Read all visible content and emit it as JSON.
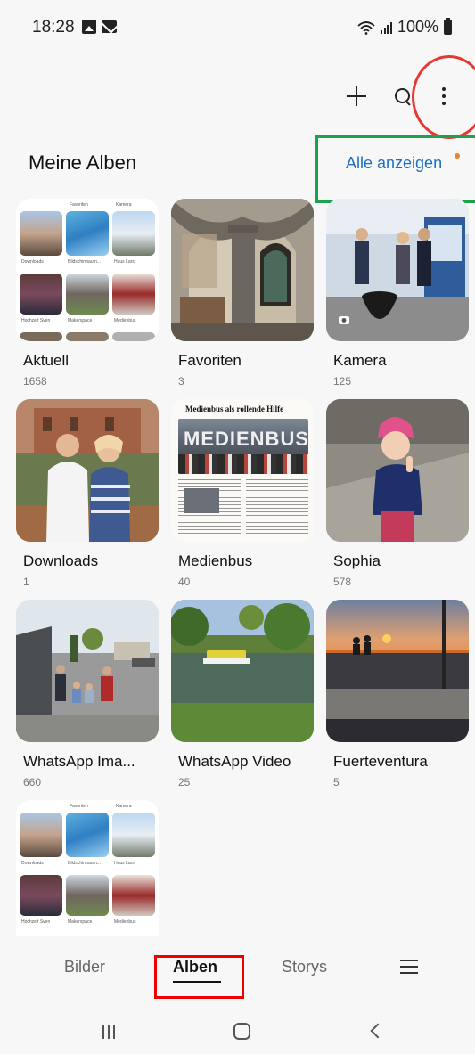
{
  "status_bar": {
    "time": "18:28",
    "battery": "100%",
    "icons": [
      "gallery-icon",
      "mail-icon",
      "wifi-icon",
      "signal-icon",
      "battery-icon"
    ]
  },
  "toolbar": {
    "icons": [
      "plus-icon",
      "search-icon",
      "more-options-icon"
    ]
  },
  "section": {
    "title": "Meine Alben",
    "see_all": "Alle anzeigen"
  },
  "albums": [
    {
      "name": "Aktuell",
      "count": "1658"
    },
    {
      "name": "Favoriten",
      "count": "3"
    },
    {
      "name": "Kamera",
      "count": "125"
    },
    {
      "name": "Downloads",
      "count": "1"
    },
    {
      "name": "Medienbus",
      "count": "40"
    },
    {
      "name": "Sophia",
      "count": "578"
    },
    {
      "name": "WhatsApp Ima...",
      "count": "660"
    },
    {
      "name": "WhatsApp Video",
      "count": "25"
    },
    {
      "name": "Fuerteventura",
      "count": "5"
    }
  ],
  "thumbnail_text": {
    "collage_labels": [
      "Favoriten",
      "Kamera",
      "Downloads",
      "Bildschirmaufn...",
      "Haus Lars",
      "Hochzeit Sven",
      "Makerspace",
      "Medienbus"
    ],
    "medienbus_headline": "Medienbus als rollende Hilfe",
    "medienbus_banner": "MEDIENBUS"
  },
  "bottom_nav": {
    "tabs": [
      "Bilder",
      "Alben",
      "Storys"
    ],
    "active_tab": "Alben",
    "menu_icon": "hamburger-menu-icon"
  },
  "system_nav": {
    "icons": [
      "recent-apps-icon",
      "home-icon",
      "back-icon"
    ]
  },
  "colors": {
    "accent_link": "#1d6fc4",
    "notification_dot": "#f08028",
    "highlight_red": "#e53935",
    "highlight_green": "#1aa34a",
    "background": "#f7f7f7"
  }
}
